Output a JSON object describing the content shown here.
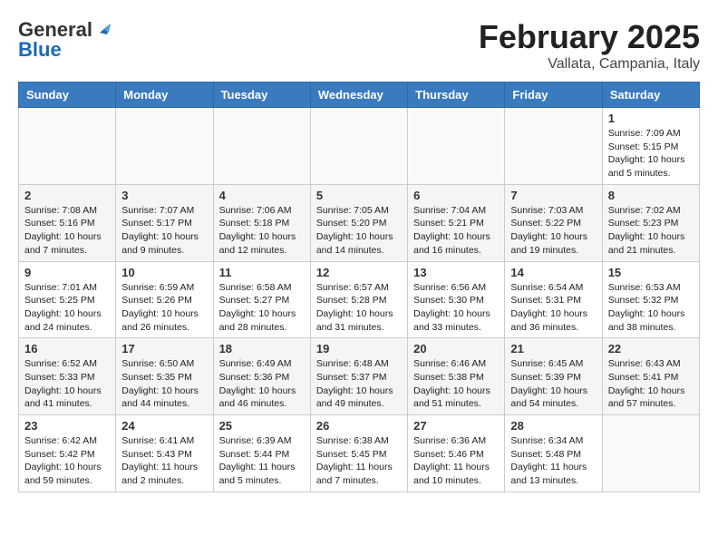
{
  "header": {
    "logo_general": "General",
    "logo_blue": "Blue",
    "title": "February 2025",
    "subtitle": "Vallata, Campania, Italy"
  },
  "weekdays": [
    "Sunday",
    "Monday",
    "Tuesday",
    "Wednesday",
    "Thursday",
    "Friday",
    "Saturday"
  ],
  "weeks": [
    [
      {
        "day": "",
        "info": ""
      },
      {
        "day": "",
        "info": ""
      },
      {
        "day": "",
        "info": ""
      },
      {
        "day": "",
        "info": ""
      },
      {
        "day": "",
        "info": ""
      },
      {
        "day": "",
        "info": ""
      },
      {
        "day": "1",
        "info": "Sunrise: 7:09 AM\nSunset: 5:15 PM\nDaylight: 10 hours and 5 minutes."
      }
    ],
    [
      {
        "day": "2",
        "info": "Sunrise: 7:08 AM\nSunset: 5:16 PM\nDaylight: 10 hours and 7 minutes."
      },
      {
        "day": "3",
        "info": "Sunrise: 7:07 AM\nSunset: 5:17 PM\nDaylight: 10 hours and 9 minutes."
      },
      {
        "day": "4",
        "info": "Sunrise: 7:06 AM\nSunset: 5:18 PM\nDaylight: 10 hours and 12 minutes."
      },
      {
        "day": "5",
        "info": "Sunrise: 7:05 AM\nSunset: 5:20 PM\nDaylight: 10 hours and 14 minutes."
      },
      {
        "day": "6",
        "info": "Sunrise: 7:04 AM\nSunset: 5:21 PM\nDaylight: 10 hours and 16 minutes."
      },
      {
        "day": "7",
        "info": "Sunrise: 7:03 AM\nSunset: 5:22 PM\nDaylight: 10 hours and 19 minutes."
      },
      {
        "day": "8",
        "info": "Sunrise: 7:02 AM\nSunset: 5:23 PM\nDaylight: 10 hours and 21 minutes."
      }
    ],
    [
      {
        "day": "9",
        "info": "Sunrise: 7:01 AM\nSunset: 5:25 PM\nDaylight: 10 hours and 24 minutes."
      },
      {
        "day": "10",
        "info": "Sunrise: 6:59 AM\nSunset: 5:26 PM\nDaylight: 10 hours and 26 minutes."
      },
      {
        "day": "11",
        "info": "Sunrise: 6:58 AM\nSunset: 5:27 PM\nDaylight: 10 hours and 28 minutes."
      },
      {
        "day": "12",
        "info": "Sunrise: 6:57 AM\nSunset: 5:28 PM\nDaylight: 10 hours and 31 minutes."
      },
      {
        "day": "13",
        "info": "Sunrise: 6:56 AM\nSunset: 5:30 PM\nDaylight: 10 hours and 33 minutes."
      },
      {
        "day": "14",
        "info": "Sunrise: 6:54 AM\nSunset: 5:31 PM\nDaylight: 10 hours and 36 minutes."
      },
      {
        "day": "15",
        "info": "Sunrise: 6:53 AM\nSunset: 5:32 PM\nDaylight: 10 hours and 38 minutes."
      }
    ],
    [
      {
        "day": "16",
        "info": "Sunrise: 6:52 AM\nSunset: 5:33 PM\nDaylight: 10 hours and 41 minutes."
      },
      {
        "day": "17",
        "info": "Sunrise: 6:50 AM\nSunset: 5:35 PM\nDaylight: 10 hours and 44 minutes."
      },
      {
        "day": "18",
        "info": "Sunrise: 6:49 AM\nSunset: 5:36 PM\nDaylight: 10 hours and 46 minutes."
      },
      {
        "day": "19",
        "info": "Sunrise: 6:48 AM\nSunset: 5:37 PM\nDaylight: 10 hours and 49 minutes."
      },
      {
        "day": "20",
        "info": "Sunrise: 6:46 AM\nSunset: 5:38 PM\nDaylight: 10 hours and 51 minutes."
      },
      {
        "day": "21",
        "info": "Sunrise: 6:45 AM\nSunset: 5:39 PM\nDaylight: 10 hours and 54 minutes."
      },
      {
        "day": "22",
        "info": "Sunrise: 6:43 AM\nSunset: 5:41 PM\nDaylight: 10 hours and 57 minutes."
      }
    ],
    [
      {
        "day": "23",
        "info": "Sunrise: 6:42 AM\nSunset: 5:42 PM\nDaylight: 10 hours and 59 minutes."
      },
      {
        "day": "24",
        "info": "Sunrise: 6:41 AM\nSunset: 5:43 PM\nDaylight: 11 hours and 2 minutes."
      },
      {
        "day": "25",
        "info": "Sunrise: 6:39 AM\nSunset: 5:44 PM\nDaylight: 11 hours and 5 minutes."
      },
      {
        "day": "26",
        "info": "Sunrise: 6:38 AM\nSunset: 5:45 PM\nDaylight: 11 hours and 7 minutes."
      },
      {
        "day": "27",
        "info": "Sunrise: 6:36 AM\nSunset: 5:46 PM\nDaylight: 11 hours and 10 minutes."
      },
      {
        "day": "28",
        "info": "Sunrise: 6:34 AM\nSunset: 5:48 PM\nDaylight: 11 hours and 13 minutes."
      },
      {
        "day": "",
        "info": ""
      }
    ]
  ]
}
